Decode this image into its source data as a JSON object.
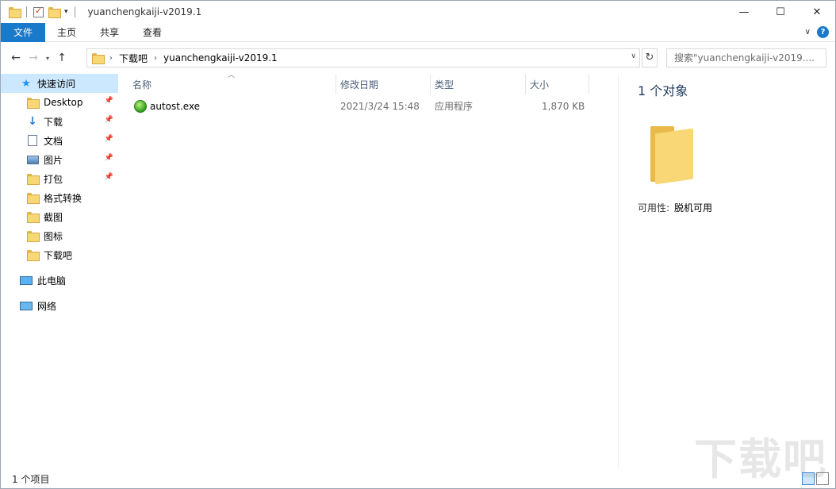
{
  "window": {
    "title": "yuanchengkaiji-v2019.1"
  },
  "ribbon": {
    "tabs": [
      "文件",
      "主页",
      "共享",
      "查看"
    ]
  },
  "address": {
    "path": [
      "下载吧",
      "yuanchengkaiji-v2019.1"
    ],
    "search_placeholder": "搜索\"yuanchengkaiji-v2019...."
  },
  "nav": {
    "items": [
      {
        "label": "快速访问",
        "icon": "star-icon"
      },
      {
        "label": "Desktop",
        "icon": "folder-icon",
        "pinned": true
      },
      {
        "label": "下载",
        "icon": "download-icon",
        "pinned": true
      },
      {
        "label": "文档",
        "icon": "document-icon",
        "pinned": true
      },
      {
        "label": "图片",
        "icon": "picture-icon",
        "pinned": true
      },
      {
        "label": "打包",
        "icon": "folder-icon",
        "pinned": true
      },
      {
        "label": "格式转换",
        "icon": "folder-icon"
      },
      {
        "label": "截图",
        "icon": "folder-icon"
      },
      {
        "label": "图标",
        "icon": "folder-icon"
      },
      {
        "label": "下载吧",
        "icon": "folder-icon"
      },
      {
        "label": "此电脑",
        "icon": "computer-icon"
      },
      {
        "label": "网络",
        "icon": "network-icon"
      }
    ]
  },
  "columns": {
    "name": "名称",
    "modified": "修改日期",
    "type": "类型",
    "size": "大小"
  },
  "files": [
    {
      "name": "autost.exe",
      "modified": "2021/3/24 15:48",
      "type": "应用程序",
      "size": "1,870 KB"
    }
  ],
  "preview": {
    "title": "1 个对象",
    "availability_label": "可用性:",
    "availability_value": "脱机可用"
  },
  "status": {
    "item_count": "1 个项目"
  },
  "watermark": "下载吧",
  "colors": {
    "accent": "#1979ca",
    "selected": "#cce8ff"
  }
}
